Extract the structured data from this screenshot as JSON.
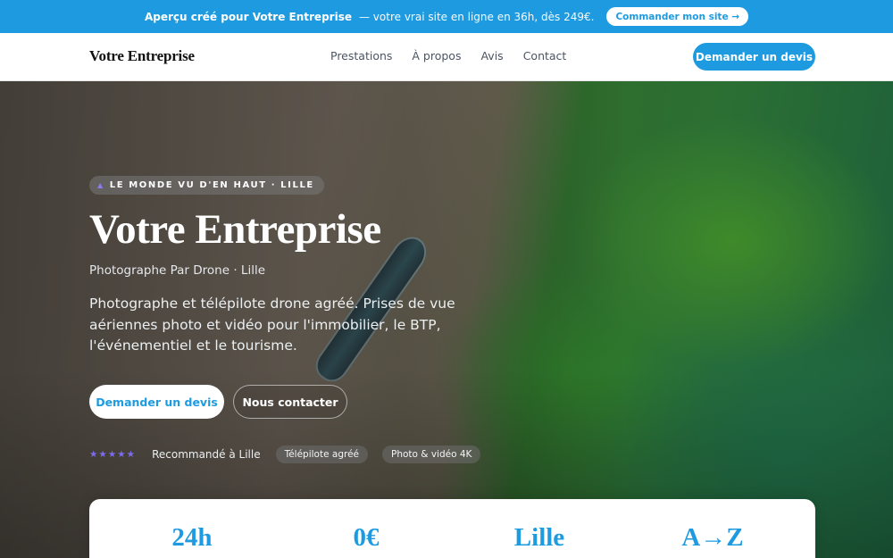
{
  "promo": {
    "bold_text": "Aperçu créé pour Votre Entreprise",
    "text": "— votre vrai site en ligne en 36h, dès 249€.",
    "button_label": "Commander mon site →"
  },
  "header": {
    "logo": "Votre Entreprise",
    "nav": [
      "Prestations",
      "À propos",
      "Avis",
      "Contact"
    ],
    "cta_label": "Demander un devis"
  },
  "hero": {
    "badge": "LE MONDE VU D'EN HAUT · LILLE",
    "badge_icon": "triangle-icon",
    "title": "Votre Entreprise",
    "subtitle": "Photographe Par Drone · Lille",
    "description": "Photographe et télépilote drone agréé. Prises de vue aériennes photo et vidéo pour l'immobilier, le BTP, l'événementiel et le tourisme.",
    "primary_button": "Demander un devis",
    "secondary_button": "Nous contacter",
    "stars": "★★★★★",
    "rating_text": "Recommandé à Lille",
    "pills": [
      "Télépilote agréé",
      "Photo & vidéo 4K"
    ]
  },
  "stats": [
    "24h",
    "0€",
    "Lille",
    "A→Z"
  ],
  "colors": {
    "accent": "#1e9be0",
    "star": "#7c6cf0"
  }
}
